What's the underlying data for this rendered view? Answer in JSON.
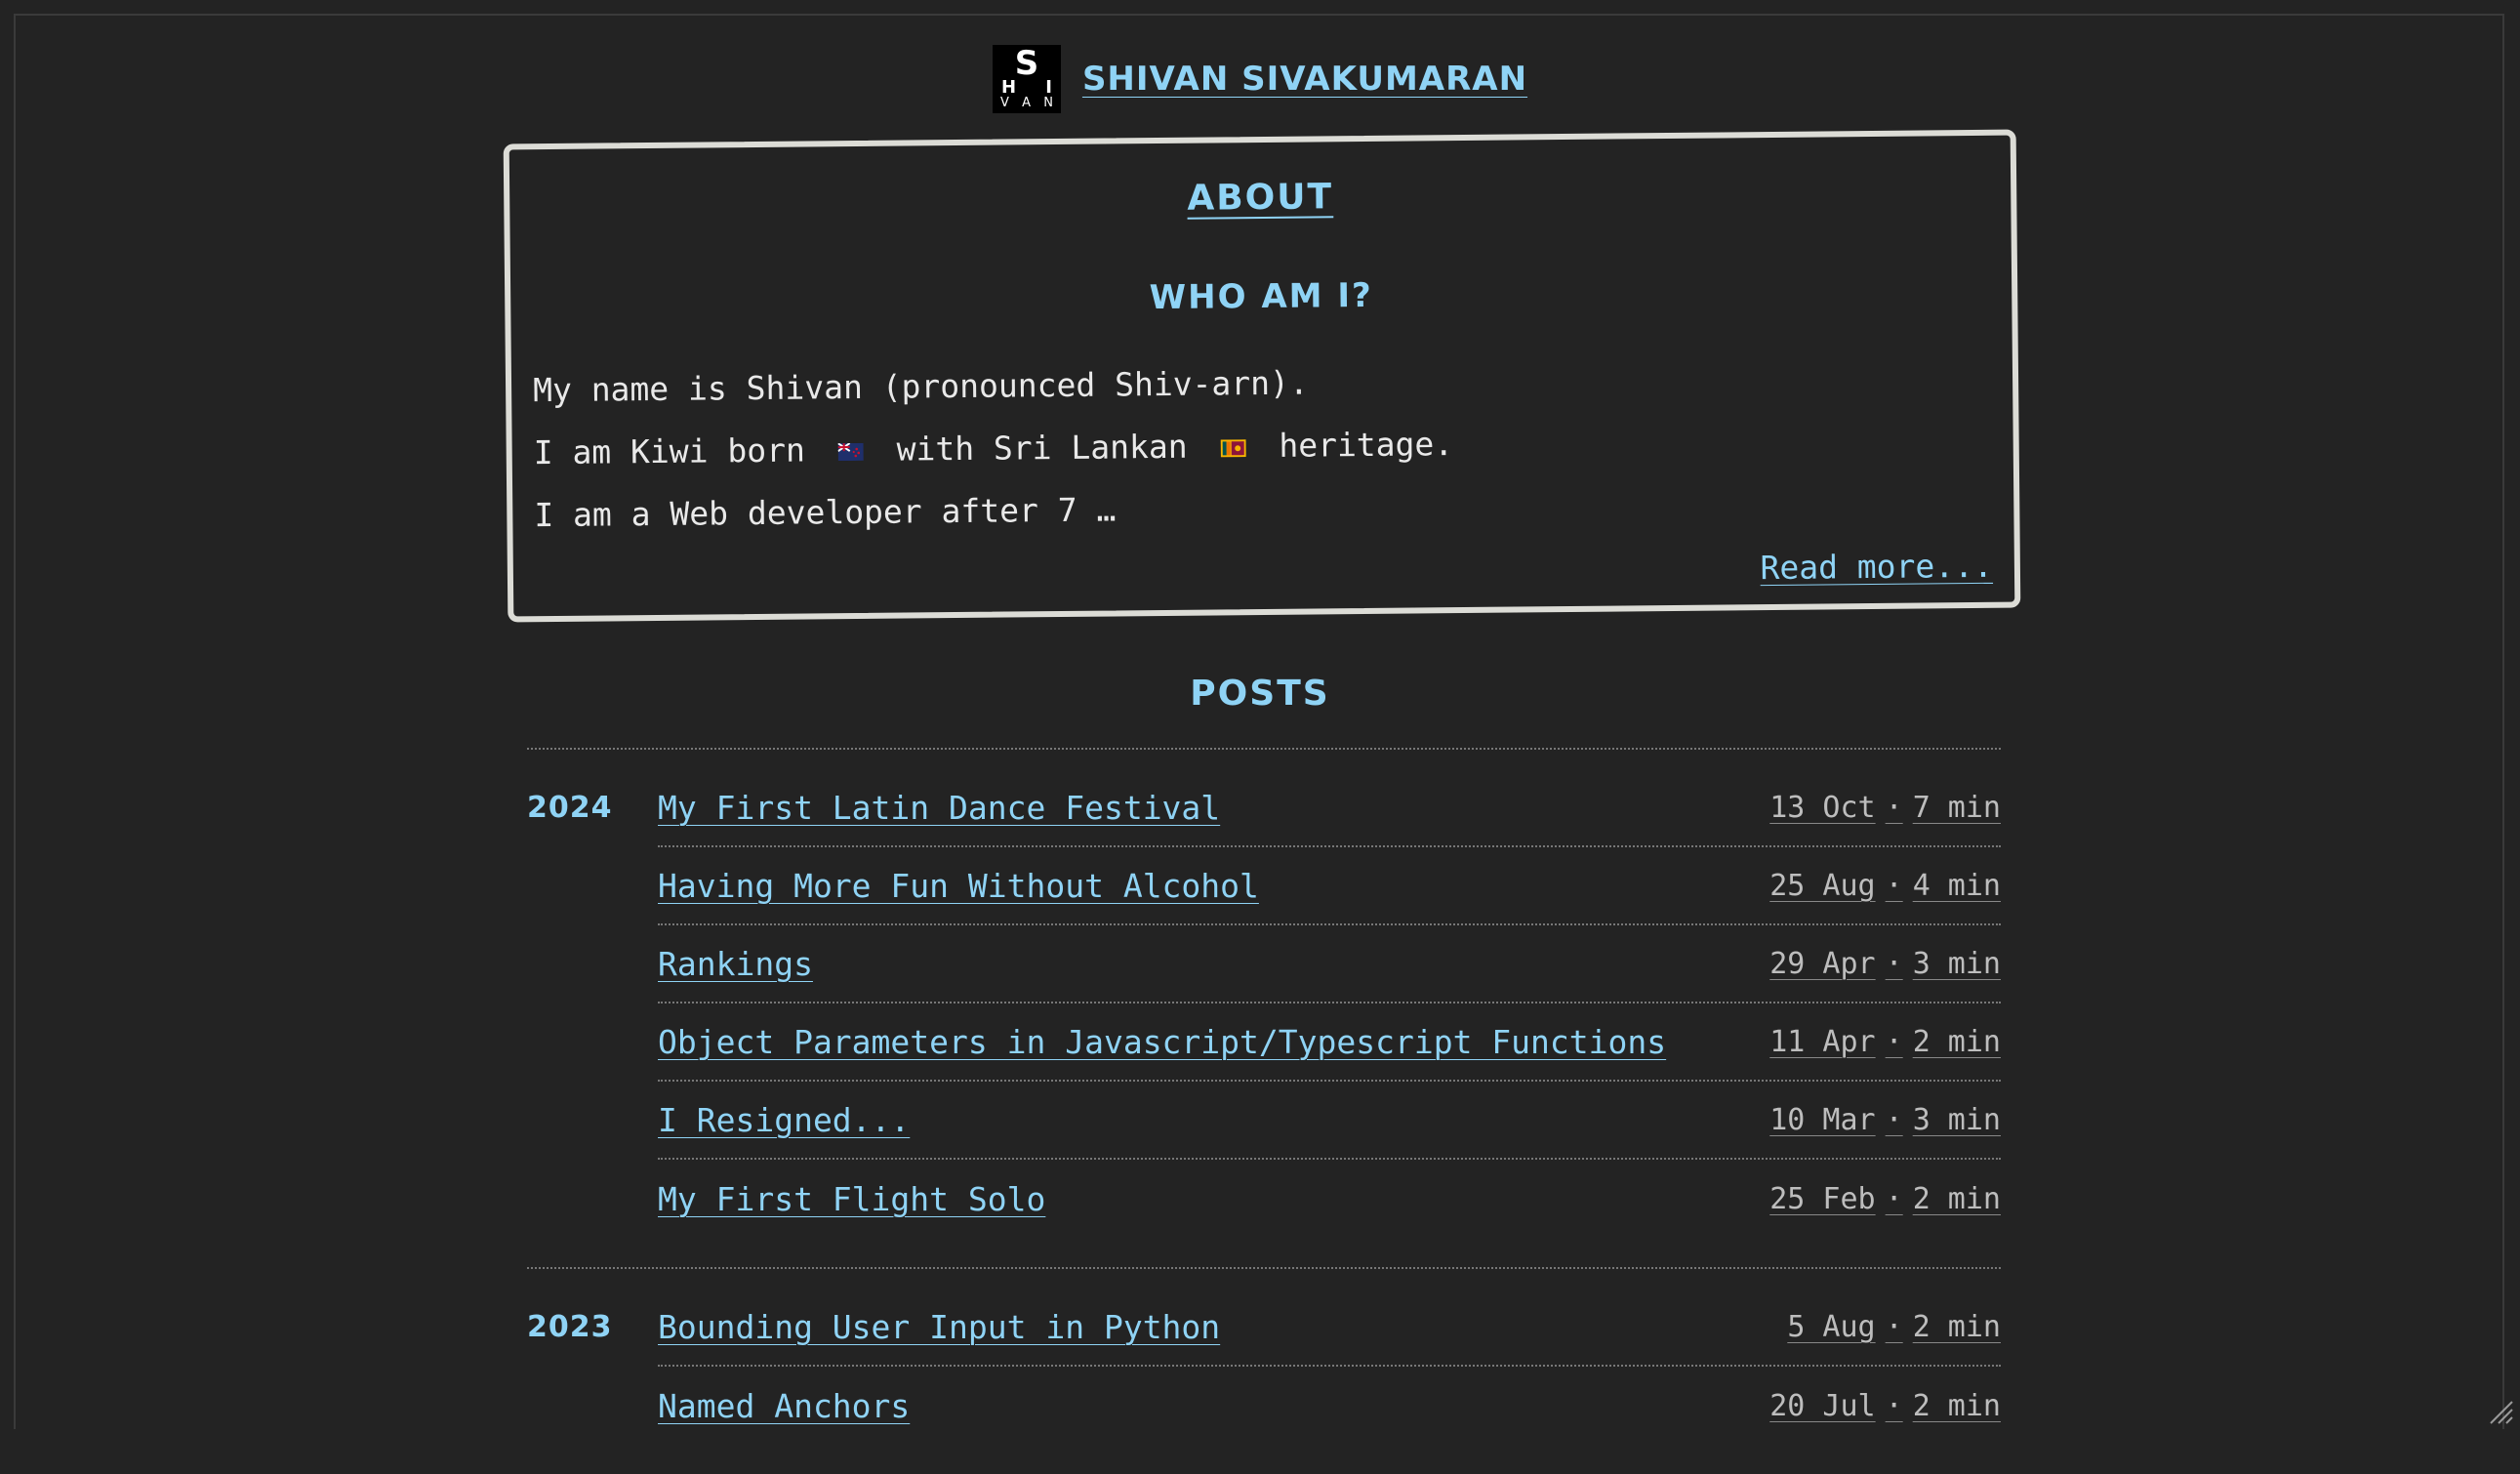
{
  "header": {
    "logo": {
      "s": "S",
      "h": "H",
      "i": "I",
      "v": "V",
      "a": "A",
      "n": "N"
    },
    "title": "SHIVAN SIVAKUMARAN"
  },
  "about": {
    "heading": "ABOUT",
    "subheading": "WHO AM I?",
    "line1": "My name is Shivan (pronounced Shiv-arn).",
    "line2_a": "I am Kiwi born",
    "line2_b": "with Sri Lankan",
    "line2_c": "heritage.",
    "line3": "I am a Web developer after 7 …",
    "read_more": "Read more..."
  },
  "posts": {
    "heading": "POSTS",
    "groups": [
      {
        "year": "2024",
        "items": [
          {
            "title": "My First Latin Dance Festival",
            "date": "13 Oct",
            "time": "7 min"
          },
          {
            "title": "Having More Fun Without Alcohol",
            "date": "25 Aug",
            "time": "4 min"
          },
          {
            "title": "Rankings",
            "date": "29 Apr",
            "time": "3 min"
          },
          {
            "title": "Object Parameters in Javascript/Typescript Functions",
            "date": "11 Apr",
            "time": "2 min"
          },
          {
            "title": "I Resigned...",
            "date": "10 Mar",
            "time": "3 min"
          },
          {
            "title": "My First Flight Solo",
            "date": "25 Feb",
            "time": "2 min"
          }
        ]
      },
      {
        "year": "2023",
        "items": [
          {
            "title": "Bounding User Input in Python",
            "date": "5 Aug",
            "time": "2 min"
          },
          {
            "title": "Named Anchors",
            "date": "20 Jul",
            "time": "2 min"
          }
        ]
      }
    ]
  },
  "colors": {
    "background": "#232323",
    "accent": "#8fd3f5",
    "text": "#e9e9e9"
  }
}
